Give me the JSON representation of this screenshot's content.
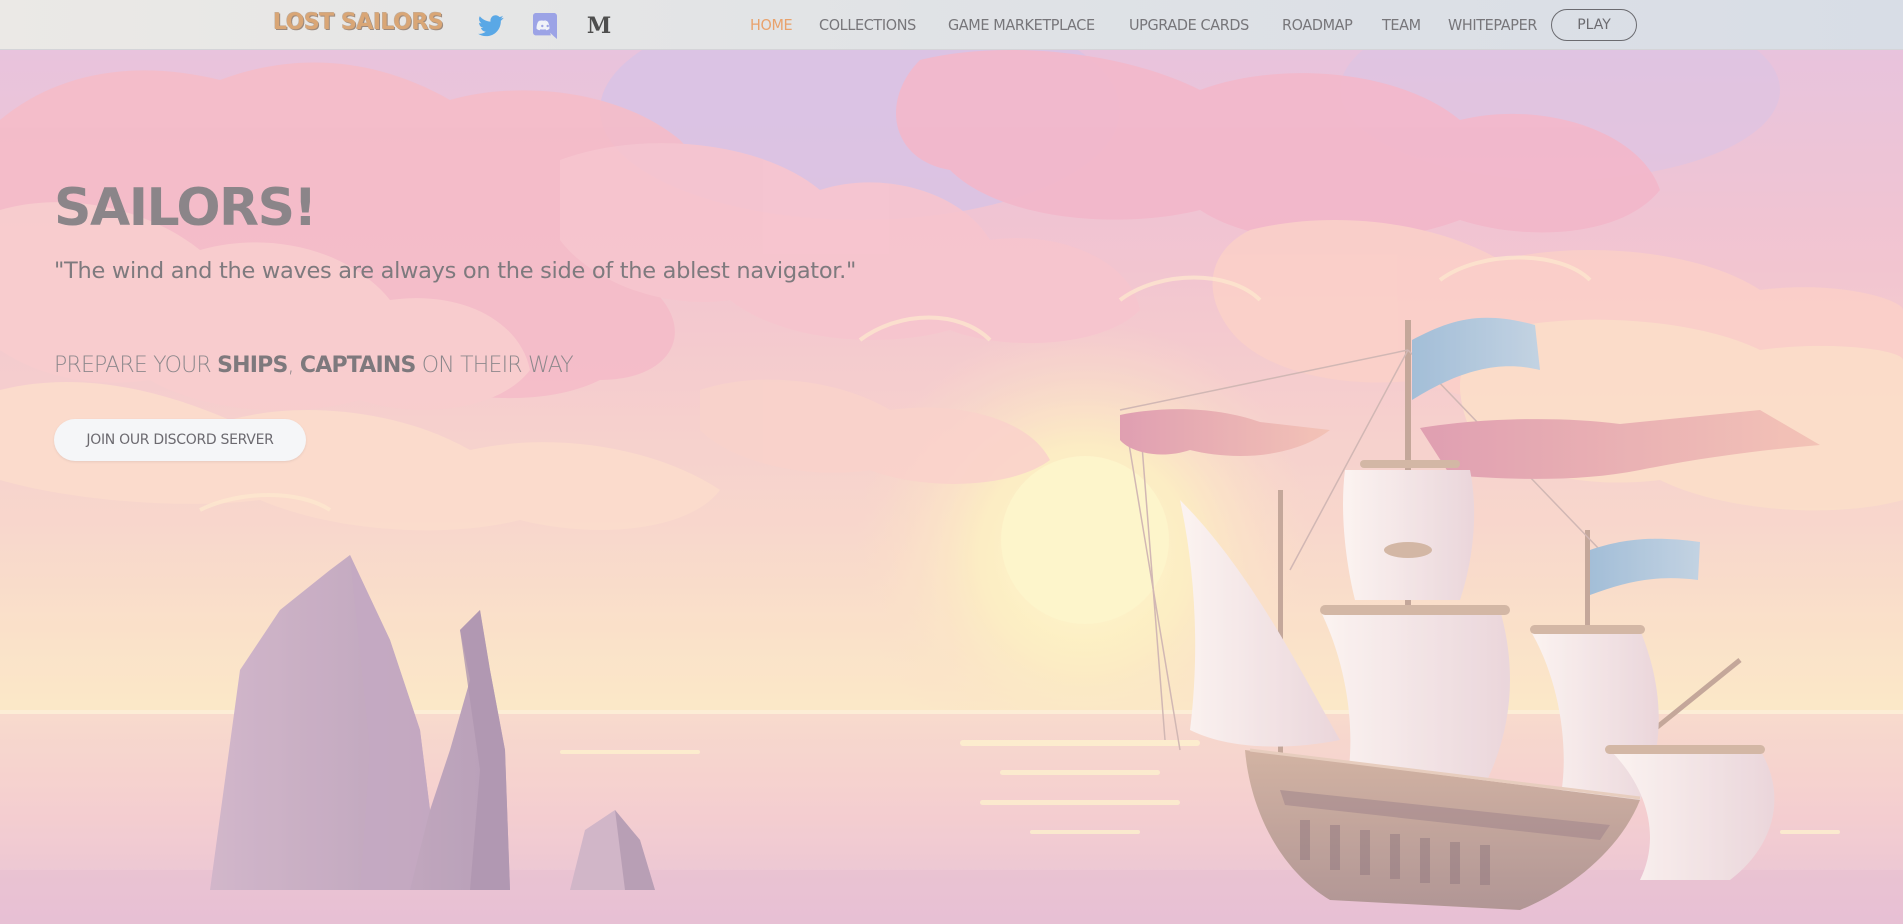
{
  "header": {
    "logo_text": "LOST SAILORS",
    "social": [
      {
        "icon": "twitter-icon",
        "color": "#5aa8e6"
      },
      {
        "icon": "discord-icon",
        "color": "#9ca3e6"
      },
      {
        "icon": "medium-icon",
        "glyph": "M",
        "color": "#4e4e4e"
      }
    ],
    "nav": [
      {
        "label": "HOME",
        "active": true
      },
      {
        "label": "COLLECTIONS",
        "active": false
      },
      {
        "label": "GAME MARKETPLACE",
        "active": false
      },
      {
        "label": "UPGRADE CARDS",
        "active": false
      },
      {
        "label": "ROADMAP",
        "active": false
      },
      {
        "label": "TEAM",
        "active": false
      },
      {
        "label": "WHITEPAPER",
        "active": false
      }
    ],
    "play_label": "PLAY",
    "colors": {
      "active": "#e9a26c",
      "nav": "#77767a",
      "logo": "#d9a676"
    }
  },
  "hero": {
    "title": "SAILORS!",
    "quote": "\"The wind and the waves are always on the side of the ablest navigator.\"",
    "subtitle_parts": {
      "prefix": "PREPARE YOUR ",
      "ships": "SHIPS",
      "comma": ", ",
      "captains": "CAPTAINS",
      "suffix": " ON THEIR WAY"
    },
    "cta_label": "JOIN OUR DISCORD SERVER"
  }
}
